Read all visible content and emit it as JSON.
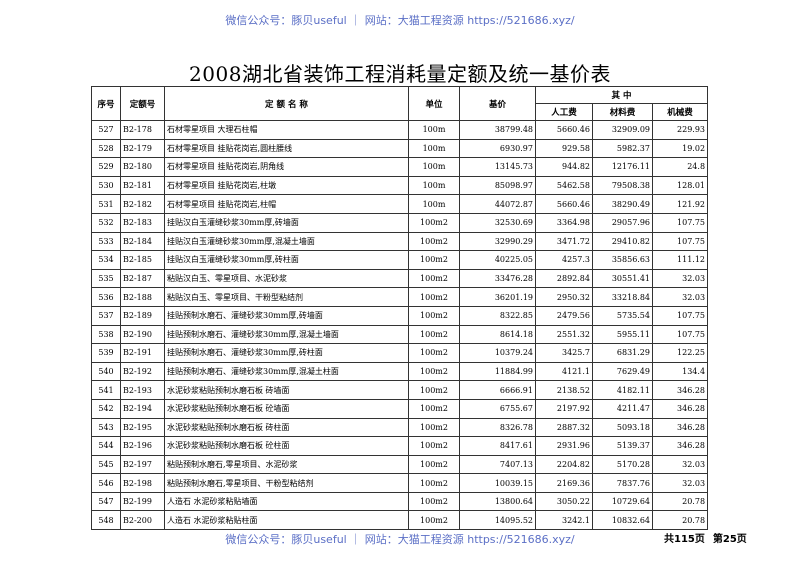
{
  "watermark_text": "微信公众号：豚贝useful ｜ 网站：大猫工程资源 https://521686.xyz/",
  "title": "2008湖北省装饰工程消耗量定额及统一基价表",
  "headers": {
    "seq": "序号",
    "code": "定额号",
    "name": "定 额 名 称",
    "unit": "单位",
    "base_price": "基价",
    "among": "其 中",
    "labor": "人工费",
    "material": "材料费",
    "machine": "机械费"
  },
  "rows": [
    {
      "seq": "527",
      "code": "B2-178",
      "name": "石材零星项目 大理石柱帽",
      "unit": "100m",
      "base": "38799.48",
      "labor": "5660.46",
      "material": "32909.09",
      "machine": "229.93"
    },
    {
      "seq": "528",
      "code": "B2-179",
      "name": "石材零星项目 挂贴花岗岩,圆柱腰线",
      "unit": "100m",
      "base": "6930.97",
      "labor": "929.58",
      "material": "5982.37",
      "machine": "19.02"
    },
    {
      "seq": "529",
      "code": "B2-180",
      "name": "石材零星项目 挂贴花岗岩,阴角线",
      "unit": "100m",
      "base": "13145.73",
      "labor": "944.82",
      "material": "12176.11",
      "machine": "24.8"
    },
    {
      "seq": "530",
      "code": "B2-181",
      "name": "石材零星项目 挂贴花岗岩,柱墩",
      "unit": "100m",
      "base": "85098.97",
      "labor": "5462.58",
      "material": "79508.38",
      "machine": "128.01"
    },
    {
      "seq": "531",
      "code": "B2-182",
      "name": "石材零星项目 挂贴花岗岩,柱帽",
      "unit": "100m",
      "base": "44072.87",
      "labor": "5660.46",
      "material": "38290.49",
      "machine": "121.92"
    },
    {
      "seq": "532",
      "code": "B2-183",
      "name": "挂贴汉白玉灌缝砂浆30mm厚,砖墙面",
      "unit": "100m2",
      "base": "32530.69",
      "labor": "3364.98",
      "material": "29057.96",
      "machine": "107.75"
    },
    {
      "seq": "533",
      "code": "B2-184",
      "name": "挂贴汉白玉灌缝砂浆30mm厚,混凝土墙面",
      "unit": "100m2",
      "base": "32990.29",
      "labor": "3471.72",
      "material": "29410.82",
      "machine": "107.75"
    },
    {
      "seq": "534",
      "code": "B2-185",
      "name": "挂贴汉白玉灌缝砂浆30mm厚,砖柱面",
      "unit": "100m2",
      "base": "40225.05",
      "labor": "4257.3",
      "material": "35856.63",
      "machine": "111.12"
    },
    {
      "seq": "535",
      "code": "B2-187",
      "name": "粘贴汉白玉、零星项目、水泥砂浆",
      "unit": "100m2",
      "base": "33476.28",
      "labor": "2892.84",
      "material": "30551.41",
      "machine": "32.03"
    },
    {
      "seq": "536",
      "code": "B2-188",
      "name": "粘贴汉白玉、零星项目、干粉型粘结剂",
      "unit": "100m2",
      "base": "36201.19",
      "labor": "2950.32",
      "material": "33218.84",
      "machine": "32.03"
    },
    {
      "seq": "537",
      "code": "B2-189",
      "name": "挂贴预制水磨石、灌缝砂浆30mm厚,砖墙面",
      "unit": "100m2",
      "base": "8322.85",
      "labor": "2479.56",
      "material": "5735.54",
      "machine": "107.75"
    },
    {
      "seq": "538",
      "code": "B2-190",
      "name": "挂贴预制水磨石、灌缝砂浆30mm厚,混凝土墙面",
      "unit": "100m2",
      "base": "8614.18",
      "labor": "2551.32",
      "material": "5955.11",
      "machine": "107.75"
    },
    {
      "seq": "539",
      "code": "B2-191",
      "name": "挂贴预制水磨石、灌缝砂浆30mm厚,砖柱面",
      "unit": "100m2",
      "base": "10379.24",
      "labor": "3425.7",
      "material": "6831.29",
      "machine": "122.25"
    },
    {
      "seq": "540",
      "code": "B2-192",
      "name": "挂贴预制水磨石、灌缝砂浆30mm厚,混凝土柱面",
      "unit": "100m2",
      "base": "11884.99",
      "labor": "4121.1",
      "material": "7629.49",
      "machine": "134.4"
    },
    {
      "seq": "541",
      "code": "B2-193",
      "name": "水泥砂浆粘贴预制水磨石板 砖墙面",
      "unit": "100m2",
      "base": "6666.91",
      "labor": "2138.52",
      "material": "4182.11",
      "machine": "346.28"
    },
    {
      "seq": "542",
      "code": "B2-194",
      "name": "水泥砂浆粘贴预制水磨石板 砼墙面",
      "unit": "100m2",
      "base": "6755.67",
      "labor": "2197.92",
      "material": "4211.47",
      "machine": "346.28"
    },
    {
      "seq": "543",
      "code": "B2-195",
      "name": "水泥砂浆粘贴预制水磨石板 砖柱面",
      "unit": "100m2",
      "base": "8326.78",
      "labor": "2887.32",
      "material": "5093.18",
      "machine": "346.28"
    },
    {
      "seq": "544",
      "code": "B2-196",
      "name": "水泥砂浆粘贴预制水磨石板 砼柱面",
      "unit": "100m2",
      "base": "8417.61",
      "labor": "2931.96",
      "material": "5139.37",
      "machine": "346.28"
    },
    {
      "seq": "545",
      "code": "B2-197",
      "name": "粘贴预制水磨石,零星项目、水泥砂浆",
      "unit": "100m2",
      "base": "7407.13",
      "labor": "2204.82",
      "material": "5170.28",
      "machine": "32.03"
    },
    {
      "seq": "546",
      "code": "B2-198",
      "name": "粘贴预制水磨石,零星项目、干粉型粘结剂",
      "unit": "100m2",
      "base": "10039.15",
      "labor": "2169.36",
      "material": "7837.76",
      "machine": "32.03"
    },
    {
      "seq": "547",
      "code": "B2-199",
      "name": "人造石 水泥砂浆粘贴墙面",
      "unit": "100m2",
      "base": "13800.64",
      "labor": "3050.22",
      "material": "10729.64",
      "machine": "20.78"
    },
    {
      "seq": "548",
      "code": "B2-200",
      "name": "人造石 水泥砂浆粘贴柱面",
      "unit": "100m2",
      "base": "14095.52",
      "labor": "3242.1",
      "material": "10832.64",
      "machine": "20.78"
    }
  ],
  "footer": {
    "total_pages": "共115页",
    "current_page": "第25页"
  }
}
